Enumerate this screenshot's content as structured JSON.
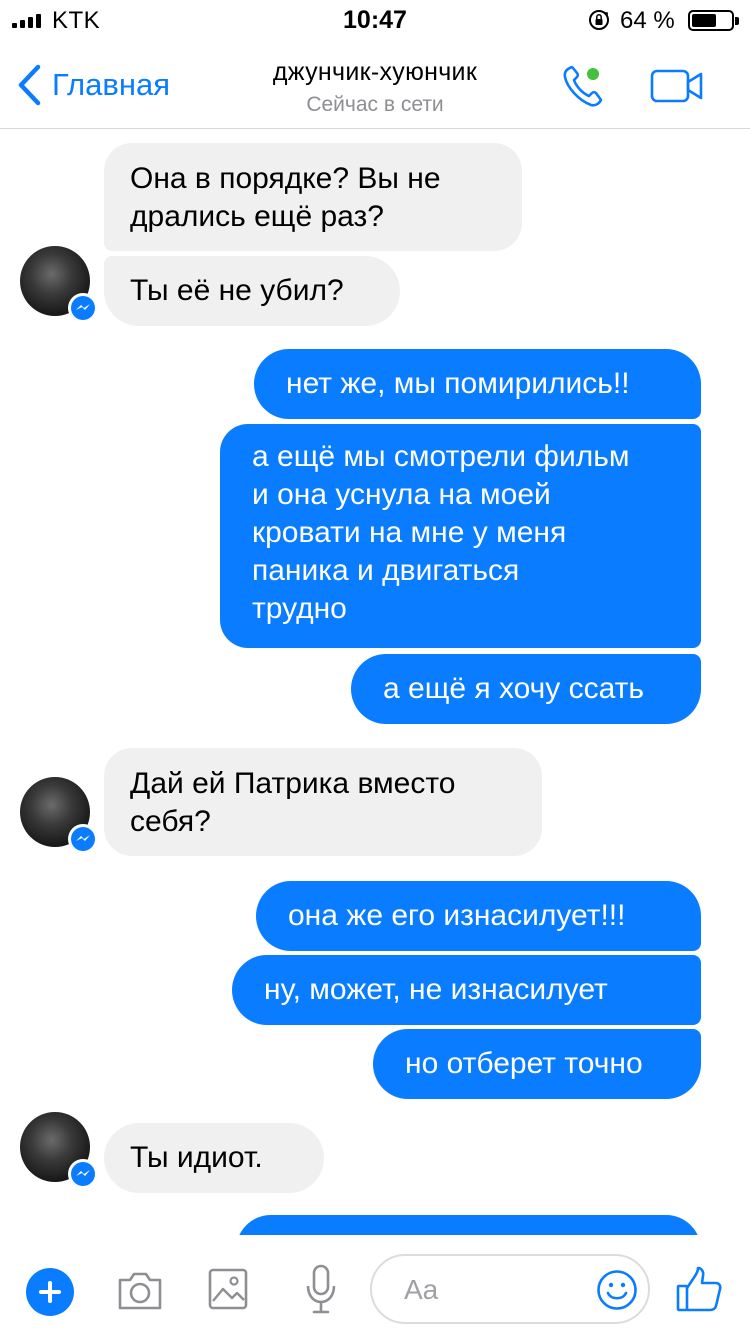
{
  "status_bar": {
    "carrier": "KTK",
    "time": "10:47",
    "battery": "64 %",
    "battery_level": 0.64
  },
  "header": {
    "back_label": "Главная",
    "title": "джунчик-хуюнчик",
    "subtitle": "Сейчас в сети",
    "online_color": "#44c13a"
  },
  "colors": {
    "accent": "#0a7cff",
    "incoming_bubble": "#f1f0f0",
    "outgoing_bubble": "#0a7cff"
  },
  "messages": [
    {
      "side": "in",
      "lines": [
        "Она в порядке? Вы не",
        "дрались ещё раз?"
      ]
    },
    {
      "side": "in",
      "lines": [
        "Ты её не убил?"
      ]
    },
    {
      "side": "out",
      "lines": [
        "нет же, мы помирились!!"
      ]
    },
    {
      "side": "out",
      "lines": [
        "а ещё мы смотрели фильм",
        "и она уснула на моей",
        "кровати на мне у меня",
        "паника и двигаться",
        "трудно"
      ]
    },
    {
      "side": "out",
      "lines": [
        "а ещё я хочу ссать"
      ]
    },
    {
      "side": "in",
      "lines": [
        "Дай ей Патрика вместо",
        "себя?"
      ]
    },
    {
      "side": "out",
      "lines": [
        "она же его изнасилует!!!"
      ]
    },
    {
      "side": "out",
      "lines": [
        "ну, может, не изнасилует"
      ]
    },
    {
      "side": "out",
      "lines": [
        "но отберет точно"
      ]
    },
    {
      "side": "in",
      "lines": [
        "Ты идиот."
      ]
    }
  ],
  "composer": {
    "placeholder": "Aa",
    "icons": [
      "plus-icon",
      "camera-icon",
      "image-icon",
      "microphone-icon",
      "emoji-icon",
      "thumbs-up-icon"
    ]
  }
}
